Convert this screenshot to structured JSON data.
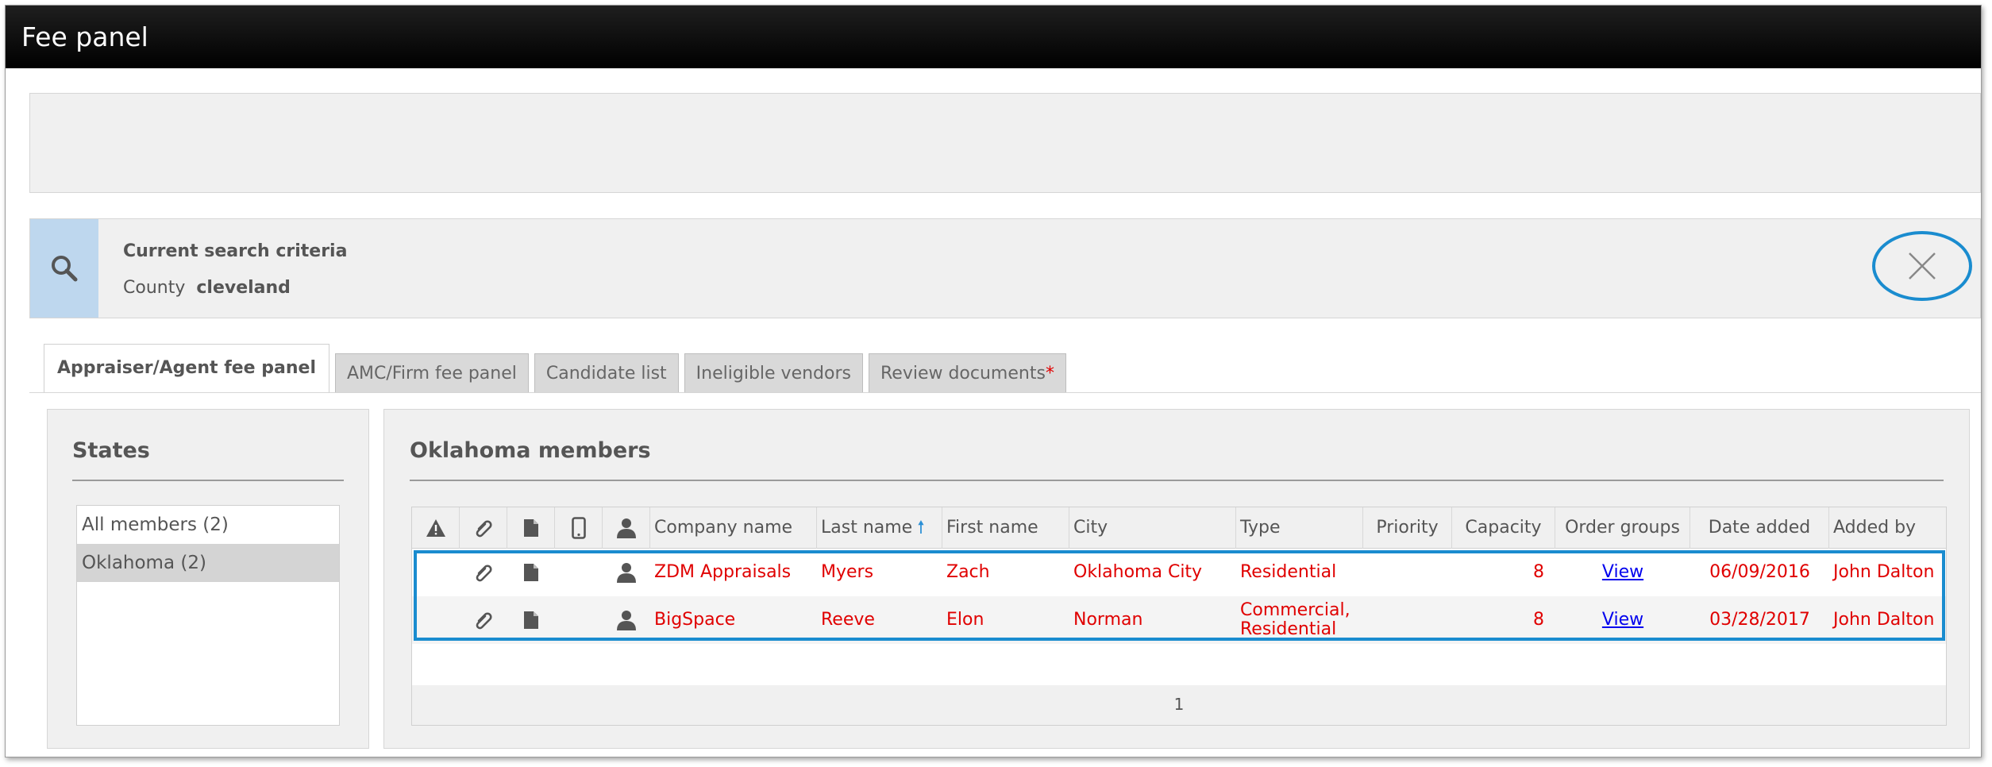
{
  "window": {
    "title": "Fee panel"
  },
  "criteria": {
    "title": "Current search criteria",
    "field_label": "County",
    "field_value": "cleveland"
  },
  "tabs": [
    {
      "label": "Appraiser/Agent fee panel",
      "active": true
    },
    {
      "label": "AMC/Firm fee panel"
    },
    {
      "label": "Candidate list"
    },
    {
      "label": "Ineligible vendors"
    },
    {
      "label": "Review documents",
      "required_marker": "*"
    }
  ],
  "states": {
    "title": "States",
    "items": [
      {
        "label": "All members (2)"
      },
      {
        "label": "Oklahoma (2)",
        "selected": true
      }
    ]
  },
  "members": {
    "title": "Oklahoma members",
    "header_icons": [
      "warning-icon",
      "paperclip-icon",
      "document-icon",
      "phone-icon",
      "person-icon"
    ],
    "columns": {
      "company": "Company name",
      "last": "Last name",
      "first": "First name",
      "city": "City",
      "type": "Type",
      "priority": "Priority",
      "capacity": "Capacity",
      "order_groups": "Order groups",
      "date_added": "Date added",
      "added_by": "Added by"
    },
    "sort_arrow": "🠕",
    "rows": [
      {
        "company": "ZDM Appraisals",
        "last": "Myers",
        "first": "Zach",
        "city": "Oklahoma City",
        "type": "Residential",
        "priority": "",
        "capacity": "8",
        "order_groups": "View",
        "date_added": "06/09/2016",
        "added_by": "John Dalton"
      },
      {
        "company": "BigSpace",
        "last": "Reeve",
        "first": "Elon",
        "city": "Norman",
        "type": "Commercial, Residential",
        "priority": "",
        "capacity": "8",
        "order_groups": "View",
        "date_added": "03/28/2017",
        "added_by": "John Dalton"
      }
    ],
    "page": "1"
  },
  "colors": {
    "accent": "#1a8ccf",
    "row_text": "#e00000",
    "link": "#0000ee"
  }
}
